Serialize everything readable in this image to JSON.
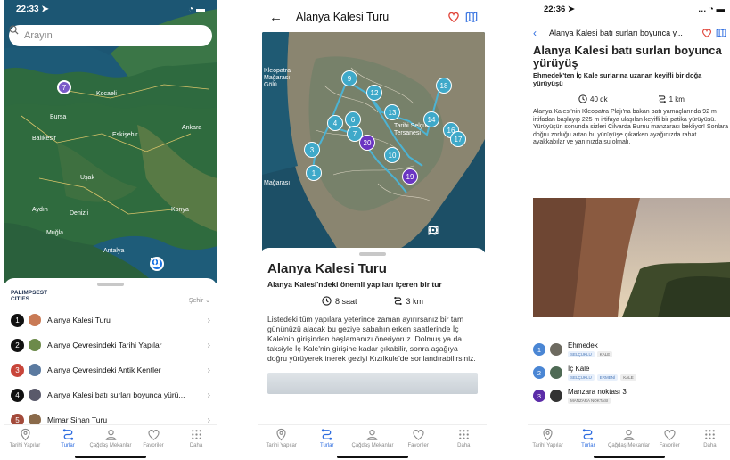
{
  "phone1": {
    "status_time": "22:33 ➤",
    "search_placeholder": "Arayın",
    "cities": [
      "Kocaeli",
      "Bursa",
      "Balıkesir",
      "Eskişehir",
      "Ankara",
      "Uşak",
      "Aydın",
      "Denizli",
      "Konya",
      "Muğla",
      "Antalya"
    ],
    "cluster_count": "7",
    "brand": "PALIMPSEST CITIES",
    "sort_label": "Şehir ⌄",
    "tours": [
      {
        "num": "1",
        "name": "Alanya Kalesi Turu",
        "style": "black"
      },
      {
        "num": "2",
        "name": "Alanya Çevresindeki Tarihi Yapılar",
        "style": "black"
      },
      {
        "num": "3",
        "name": "Alanya Çevresindeki Antik Kentler",
        "style": "red"
      },
      {
        "num": "4",
        "name": "Alanya Kalesi batı surları boyunca yürü...",
        "style": "black"
      },
      {
        "num": "5",
        "name": "Mimar Sinan Turu",
        "style": "brown"
      }
    ]
  },
  "phone2": {
    "title": "Alanya Kalesi Turu",
    "map_labels": {
      "kleopatra": "Kleopatra Mağarası Gölü",
      "tersane": "Tarihi Selçuklu Tersanesi",
      "magarasi": "Mağarası"
    },
    "markers": [
      "9",
      "12",
      "18",
      "13",
      "14",
      "16",
      "17",
      "6",
      "4",
      "7",
      "20",
      "3",
      "10",
      "19",
      "1"
    ],
    "tour_title": "Alanya Kalesi Turu",
    "tour_subtitle": "Alanya Kalesi'ndeki önemli yapıları içeren bir tur",
    "duration": "8 saat",
    "distance": "3 km",
    "description": "Listedeki tüm yapılara yeterince zaman ayırırsanız bir tam gününüzü alacak bu geziye sabahın erken saatlerinde İç Kale'nin girişinden başlamanızı öneriyoruz. Dolmuş ya da taksiyle İç Kale'nin girişine kadar çıkabilir, sonra aşağıya doğru yürüyerek inerek geziyi Kızılkule'de sonlandırabilirsiniz."
  },
  "phone3": {
    "status_time": "22:36 ➤",
    "header_title": "Alanya Kalesi batı surları boyunca y...",
    "title": "Alanya Kalesi batı surları boyunca yürüyüş",
    "subtitle": "Ehmedek'ten İç Kale surlarına uzanan keyifli bir doğa yürüyüşü",
    "duration": "40 dk",
    "distance": "1 km",
    "description": "Alanya Kalesi'nin Kleopatra Plajı'na bakan batı yamaçlarında 92 m irtifadan başlayıp 225 m irtifaya ulaşılan keyifli bir patika yürüyüşü. Yürüyüşün sonunda sizleri Cilvarda Burnu manzarası bekliyor! Sonlara doğru zorluğu artan bu yürüyüşe çıkarken ayağınızda rahat ayakkabılar ve yanınızda su olmalı.",
    "stops": [
      {
        "num": "1",
        "name": "Ehmedek",
        "tags": [
          "SELÇUKLU",
          "KALE"
        ]
      },
      {
        "num": "2",
        "name": "İç Kale",
        "tags": [
          "SELÇUKLU",
          "ERMENİ",
          "KALE"
        ]
      },
      {
        "num": "3",
        "name": "Manzara noktası 3",
        "tags": [
          "MANZARA NOKTASI"
        ]
      }
    ]
  },
  "tabs": [
    "Tarihi Yapılar",
    "Turlar",
    "Çağdaş Mekanlar",
    "Favoriler",
    "Daha"
  ],
  "colors": {
    "accent": "#2d6cdf",
    "marker": "#3fa9c9",
    "marker_purple": "#6a35c2",
    "heart": "#e0453a"
  }
}
